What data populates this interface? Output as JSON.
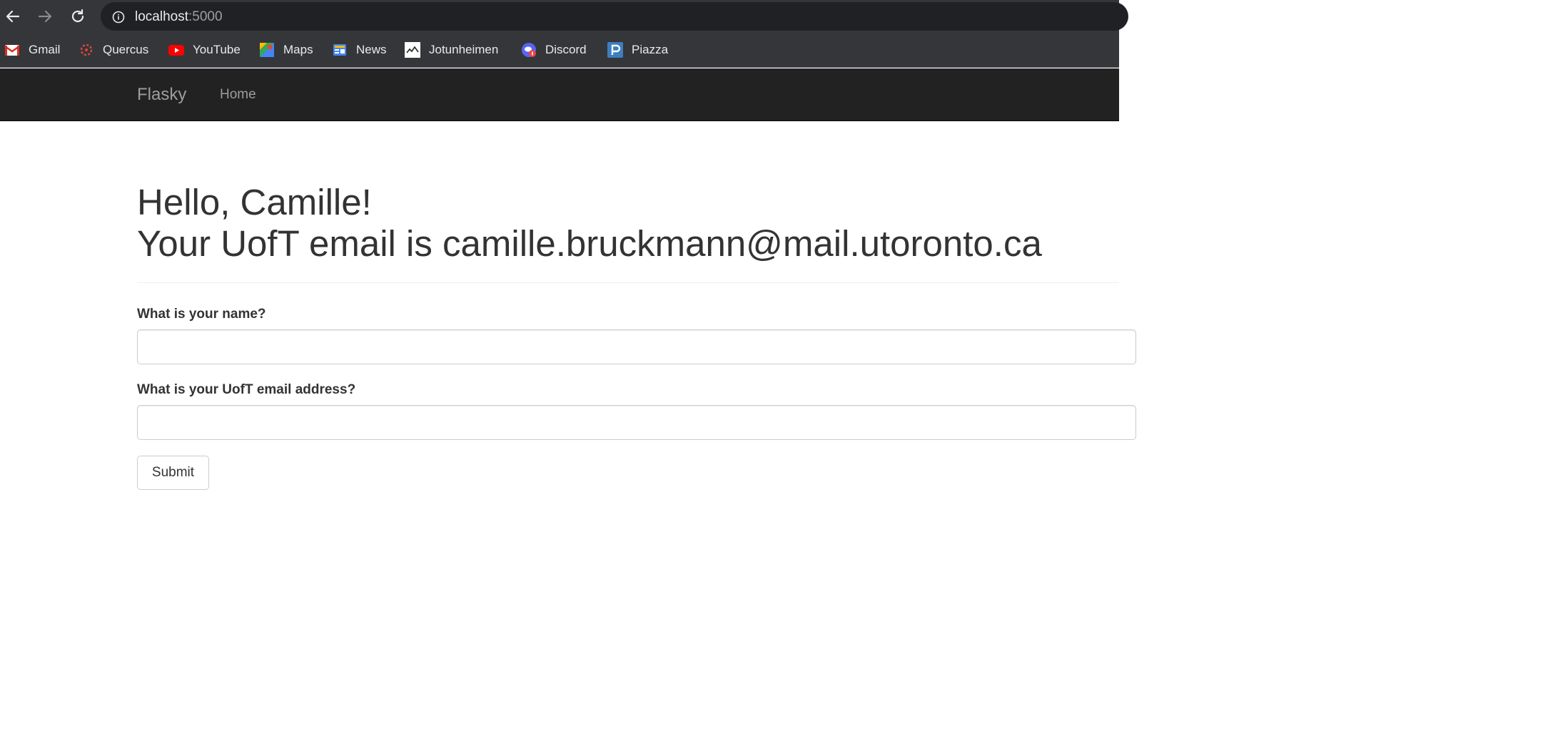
{
  "browser": {
    "url_host": "localhost",
    "url_port": ":5000",
    "bookmarks": [
      {
        "label": "Gmail",
        "icon": "gmail-icon"
      },
      {
        "label": "Quercus",
        "icon": "quercus-icon"
      },
      {
        "label": "YouTube",
        "icon": "youtube-icon"
      },
      {
        "label": "Maps",
        "icon": "maps-icon"
      },
      {
        "label": "News",
        "icon": "news-icon"
      },
      {
        "label": "Jotunheimen",
        "icon": "jotunheimen-icon"
      },
      {
        "label": "Discord",
        "icon": "discord-icon"
      },
      {
        "label": "Piazza",
        "icon": "piazza-icon"
      }
    ]
  },
  "navbar": {
    "brand": "Flasky",
    "home": "Home"
  },
  "main": {
    "greeting": "Hello, Camille!",
    "email_line": "Your UofT email is camille.bruckmann@mail.utoronto.ca",
    "name_label": "What is your name?",
    "name_value": "",
    "email_label": "What is your UofT email address?",
    "email_value": "",
    "submit_label": "Submit"
  },
  "colors": {
    "navbar_bg": "#222222",
    "navbar_text": "#9d9d9d",
    "chrome_bg": "#35363a",
    "text": "#333333"
  }
}
